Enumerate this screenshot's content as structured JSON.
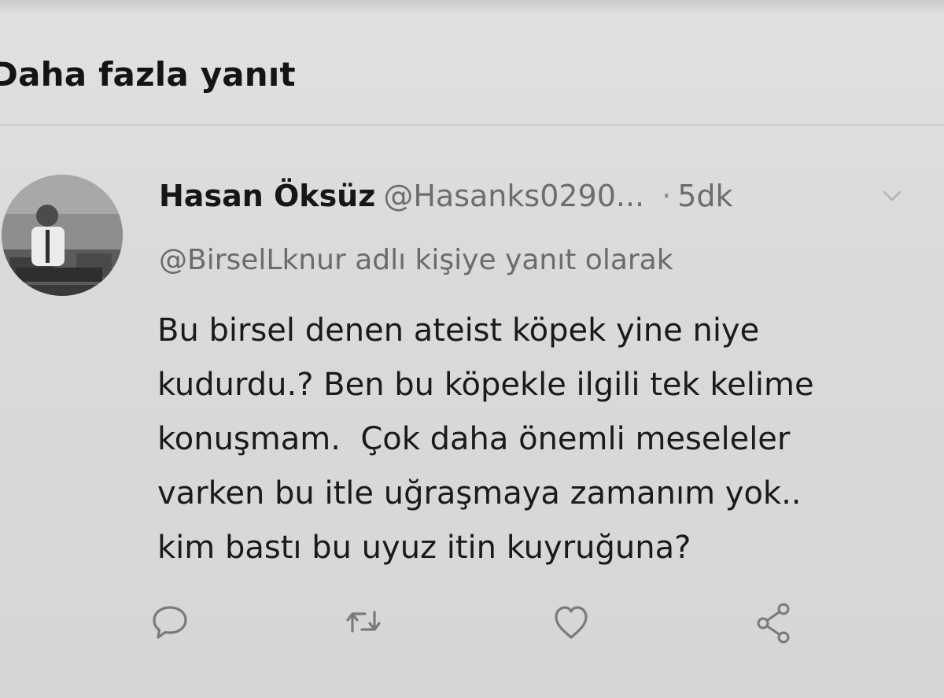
{
  "header": {
    "title": "Daha fazla yanıt"
  },
  "tweet": {
    "display_name": "Hasan Öksüz",
    "handle": "@Hasanks0290...",
    "separator": "·",
    "time": "5dk",
    "reply_to": "@BirselLknur adlı kişiye yanıt olarak",
    "text_lines": [
      "Bu birsel denen ateist köpek yine niye",
      "kudurdu.? Ben bu köpekle ilgili tek kelime",
      "konuşmam.  Çok daha önemli meseleler",
      "varken bu itle uğraşmaya zamanım yok..",
      "kim bastı bu uyuz itin kuyruğuna?"
    ]
  },
  "actions": [
    {
      "name": "reply",
      "icon": "reply-icon"
    },
    {
      "name": "retweet",
      "icon": "retweet-icon"
    },
    {
      "name": "like",
      "icon": "heart-icon"
    },
    {
      "name": "share",
      "icon": "share-icon"
    }
  ],
  "colors": {
    "background": "#dadada",
    "primary_text": "#1a1a1a",
    "secondary_text": "#6d6d6d",
    "icon": "#7a7a7a"
  }
}
